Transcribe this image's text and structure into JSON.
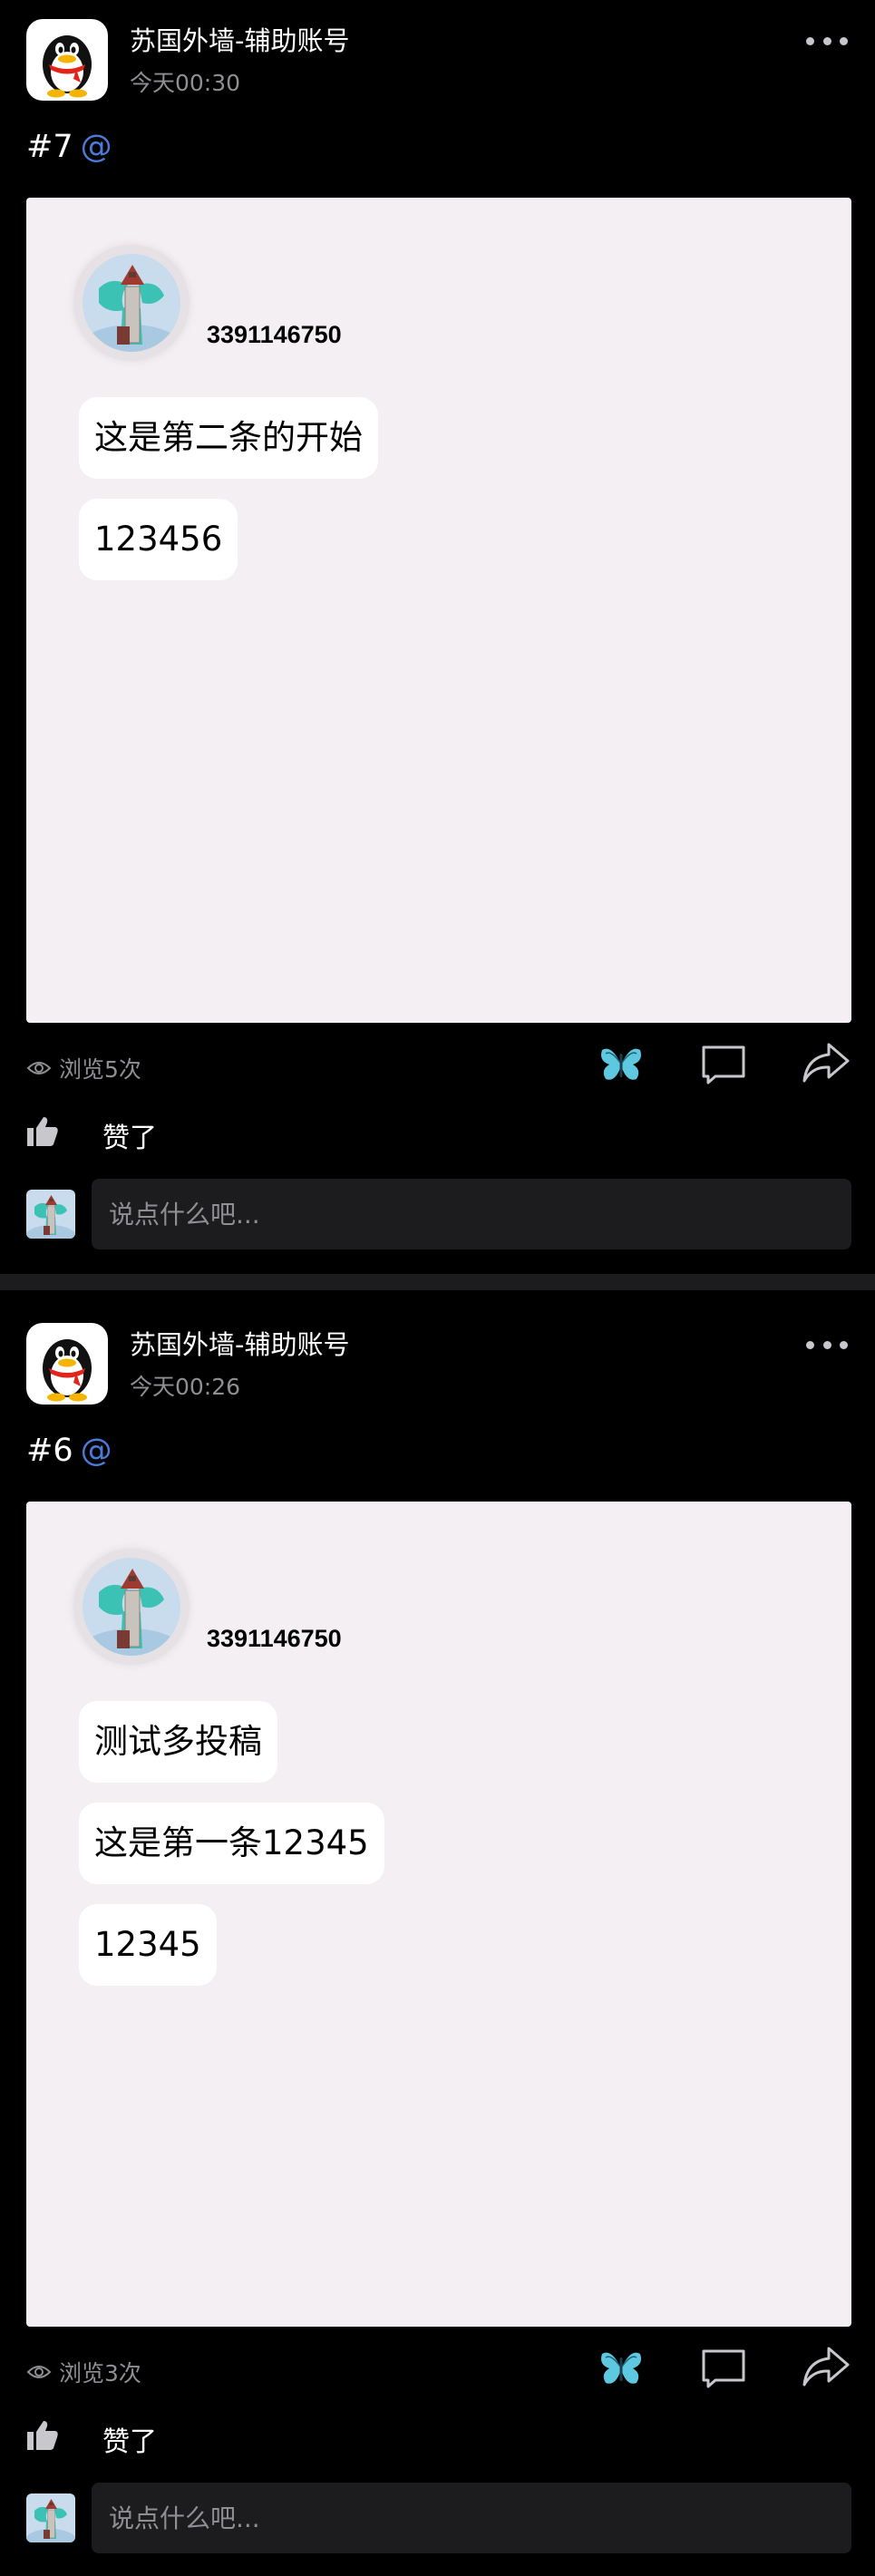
{
  "colors": {
    "background": "#000000",
    "card": "#f4eff3",
    "accent_mention": "#4a7bd8",
    "secondary_text": "#8e8e93",
    "input_background": "#1c1c1e",
    "butterfly": "#5ec8e0"
  },
  "icons": {
    "more": "more-dots-icon",
    "eye": "eye-icon",
    "butterfly": "butterfly-icon",
    "comment": "comment-icon",
    "share": "share-icon",
    "like": "thumbs-up-icon"
  },
  "posts": [
    {
      "author": "苏国外墙-辅助账号",
      "time": "今天00:30",
      "tag": "#7",
      "mention": "@",
      "card": {
        "qq_number": "3391146750",
        "messages": [
          "这是第二条的开始",
          "123456"
        ]
      },
      "views": "浏览5次",
      "likes": "赞了",
      "comment_placeholder": "说点什么吧..."
    },
    {
      "author": "苏国外墙-辅助账号",
      "time": "今天00:26",
      "tag": "#6",
      "mention": "@",
      "card": {
        "qq_number": "3391146750",
        "messages": [
          "测试多投稿",
          "这是第一条12345",
          "12345"
        ]
      },
      "views": "浏览3次",
      "likes": "赞了",
      "comment_placeholder": "说点什么吧..."
    }
  ]
}
